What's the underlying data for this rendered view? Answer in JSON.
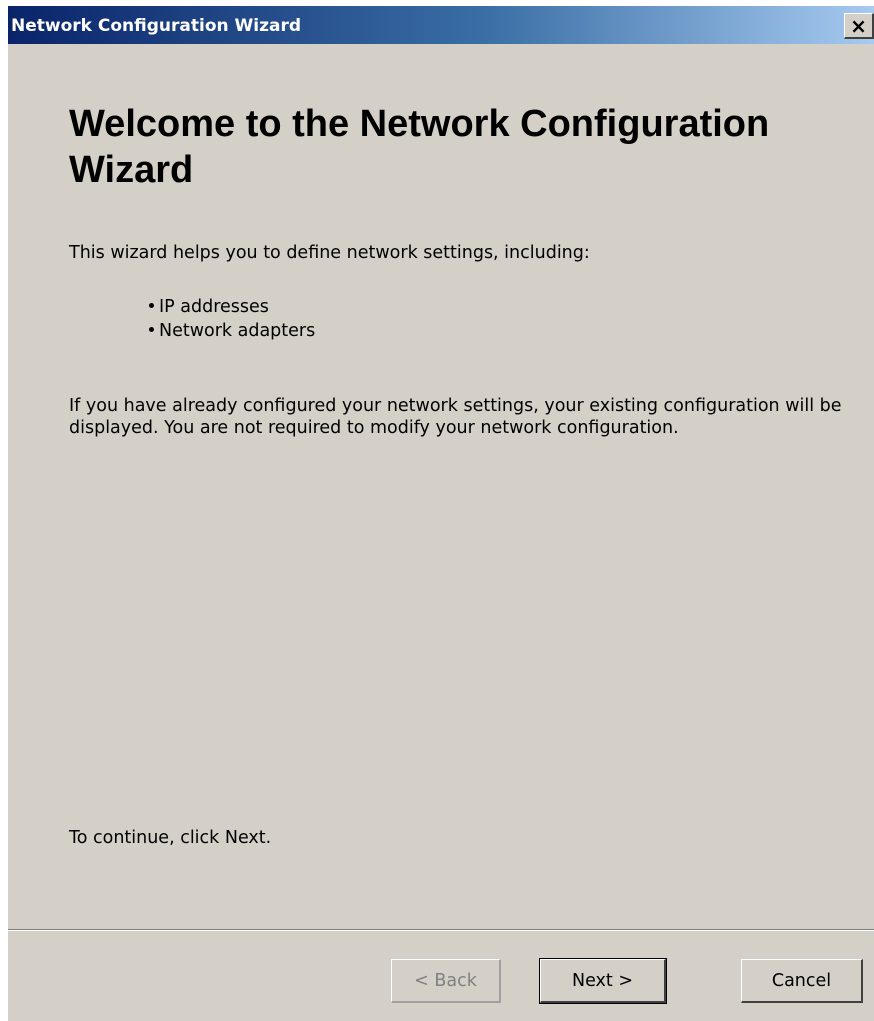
{
  "window": {
    "title": "Network Configuration Wizard",
    "close_glyph": "×"
  },
  "page": {
    "heading": "Welcome to the Network Configuration Wizard",
    "intro": "This wizard helps you to define network settings, including:",
    "bullets": [
      "IP addresses",
      "Network adapters"
    ],
    "existing_config_note": "If you have already configured your network settings, your existing configuration will be displayed. You are not required to modify your network configuration.",
    "continue_hint": "To continue, click Next."
  },
  "buttons": {
    "back": "< Back",
    "next": "Next >",
    "cancel": "Cancel",
    "back_enabled": false
  }
}
